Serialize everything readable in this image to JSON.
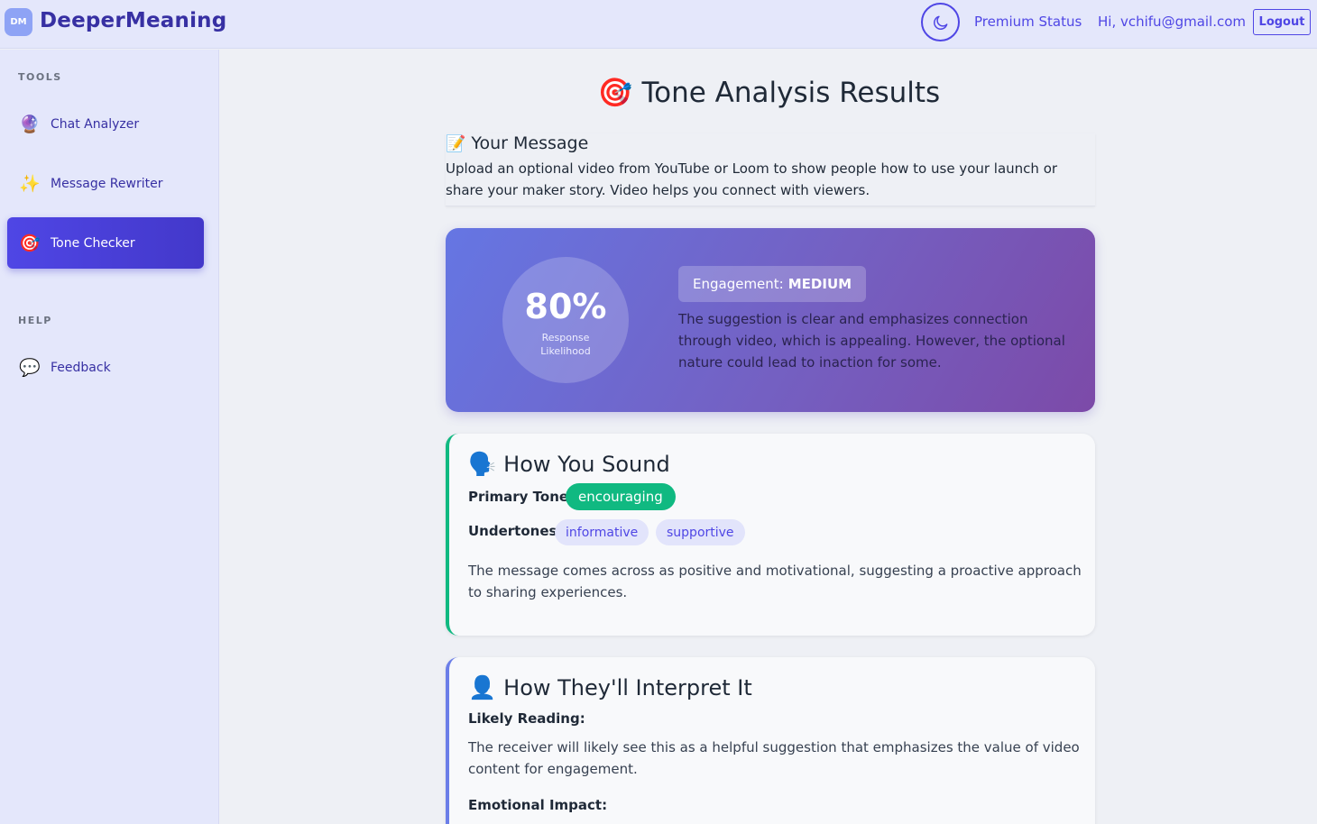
{
  "header": {
    "logo_initials": "DM",
    "brand": "DeeperMeaning",
    "premium": "Premium Status",
    "greeting": "Hi, vchifu@gmail.com",
    "logout": "Logout"
  },
  "sidebar": {
    "tools_title": "TOOLS",
    "help_title": "HELP",
    "items": [
      {
        "icon": "🔮",
        "label": "Chat Analyzer"
      },
      {
        "icon": "✨",
        "label": "Message Rewriter"
      },
      {
        "icon": "🎯",
        "label": "Tone Checker"
      },
      {
        "icon": "💬",
        "label": "Feedback"
      }
    ]
  },
  "main": {
    "title_icon": "🎯",
    "title": "Tone Analysis Results",
    "message": {
      "icon": "📝",
      "heading": "Your Message",
      "text": "Upload an optional video from YouTube or Loom to show people how to use your launch or share your maker story. Video helps you connect with viewers."
    },
    "score": {
      "percent": "80%",
      "label_line1": "Response",
      "label_line2": "Likelihood",
      "engagement_label": "Engagement:",
      "engagement_value": "MEDIUM",
      "description": "The suggestion is clear and emphasizes connection through video, which is appealing. However, the optional nature could lead to inaction for some."
    },
    "sound": {
      "icon": "🗣️",
      "heading": "How You Sound",
      "primary_label": "Primary Tone:",
      "primary_value": "encouraging",
      "undertones_label": "Undertones:",
      "undertones": [
        "informative",
        "supportive"
      ],
      "description": "The message comes across as positive and motivational, suggesting a proactive approach to sharing experiences."
    },
    "interpret": {
      "icon": "👤",
      "heading": "How They'll Interpret It",
      "likely_label": "Likely Reading:",
      "likely_text": "The receiver will likely see this as a helpful suggestion that emphasizes the value of video content for engagement.",
      "emotional_label": "Emotional Impact:"
    }
  },
  "colors": {
    "accent": "#4f46e5",
    "primary_tone": "#10b981",
    "sidebar_bg": "#e4e7fb"
  }
}
